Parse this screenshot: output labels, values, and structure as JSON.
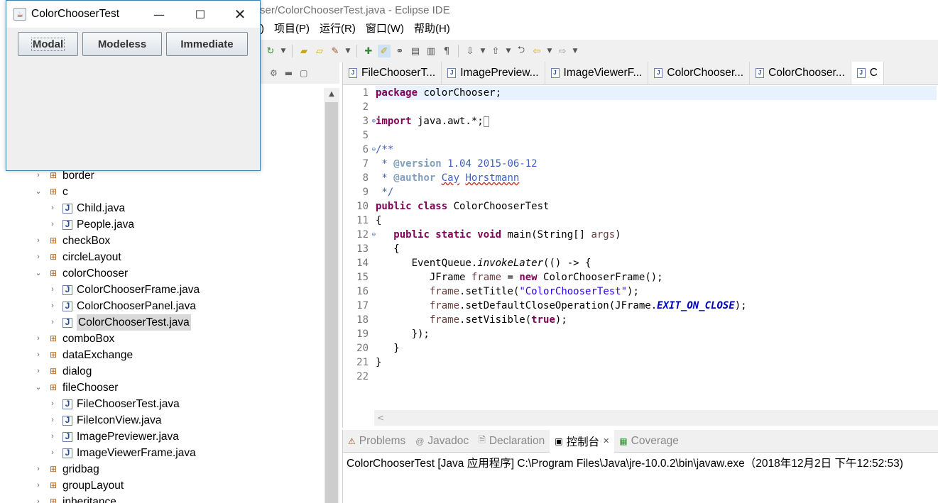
{
  "eclipse": {
    "title_fragment": "ser/ColorChooserTest.java - Eclipse IDE",
    "menu": [
      ")",
      "项目(P)",
      "运行(R)",
      "窗口(W)",
      "帮助(H)"
    ]
  },
  "swing_window": {
    "title": "ColorChooserTest",
    "buttons": [
      "Modal",
      "Modeless",
      "Immediate"
    ],
    "minimize_glyph": "—",
    "maximize_glyph": "☐",
    "close_glyph": "✕"
  },
  "explorer": {
    "rows": [
      {
        "label": "border",
        "kind": "package",
        "expanded": false,
        "indent": 0
      },
      {
        "label": "c",
        "kind": "package",
        "expanded": true,
        "indent": 0
      },
      {
        "label": "Child.java",
        "kind": "java",
        "expanded": false,
        "indent": 1
      },
      {
        "label": "People.java",
        "kind": "java",
        "expanded": false,
        "indent": 1
      },
      {
        "label": "checkBox",
        "kind": "package",
        "expanded": false,
        "indent": 0
      },
      {
        "label": "circleLayout",
        "kind": "package",
        "expanded": false,
        "indent": 0
      },
      {
        "label": "colorChooser",
        "kind": "package",
        "expanded": true,
        "indent": 0
      },
      {
        "label": "ColorChooserFrame.java",
        "kind": "java",
        "expanded": false,
        "indent": 1
      },
      {
        "label": "ColorChooserPanel.java",
        "kind": "java",
        "expanded": false,
        "indent": 1
      },
      {
        "label": "ColorChooserTest.java",
        "kind": "java",
        "expanded": false,
        "indent": 1,
        "selected": true
      },
      {
        "label": "comboBox",
        "kind": "package",
        "expanded": false,
        "indent": 0
      },
      {
        "label": "dataExchange",
        "kind": "package",
        "expanded": false,
        "indent": 0
      },
      {
        "label": "dialog",
        "kind": "package",
        "expanded": false,
        "indent": 0
      },
      {
        "label": "fileChooser",
        "kind": "package",
        "expanded": true,
        "indent": 0
      },
      {
        "label": "FileChooserTest.java",
        "kind": "java",
        "expanded": false,
        "indent": 1
      },
      {
        "label": "FileIconView.java",
        "kind": "java",
        "expanded": false,
        "indent": 1
      },
      {
        "label": "ImagePreviewer.java",
        "kind": "java",
        "expanded": false,
        "indent": 1
      },
      {
        "label": "ImageViewerFrame.java",
        "kind": "java",
        "expanded": false,
        "indent": 1
      },
      {
        "label": "gridbag",
        "kind": "package",
        "expanded": false,
        "indent": 0
      },
      {
        "label": "groupLayout",
        "kind": "package",
        "expanded": false,
        "indent": 0
      },
      {
        "label": "inheritance",
        "kind": "package",
        "expanded": false,
        "indent": 0
      }
    ]
  },
  "editor": {
    "tabs": [
      "FileChooserT...",
      "ImagePreview...",
      "ImageViewerF...",
      "ColorChooser...",
      "ColorChooser...",
      "C"
    ],
    "line_numbers": [
      "1",
      "2",
      "3",
      "5",
      "6",
      "7",
      "8",
      "9",
      "10",
      "11",
      "12",
      "13",
      "14",
      "15",
      "16",
      "17",
      "18",
      "19",
      "20",
      "21",
      "22"
    ]
  },
  "console": {
    "tabs": [
      "Problems",
      "Javadoc",
      "Declaration",
      "控制台",
      "Coverage"
    ],
    "close_glyph": "✕",
    "status_line": "ColorChooserTest [Java 应用程序] C:\\Program Files\\Java\\jre-10.0.2\\bin\\javaw.exe（2018年12月2日 下午12:52:53)"
  },
  "colors": {
    "keyword": "#7f0055",
    "comment": "#3f5fbf",
    "string": "#2a00ff",
    "field": "#0000c0",
    "current_line": "#e8f2fe"
  }
}
